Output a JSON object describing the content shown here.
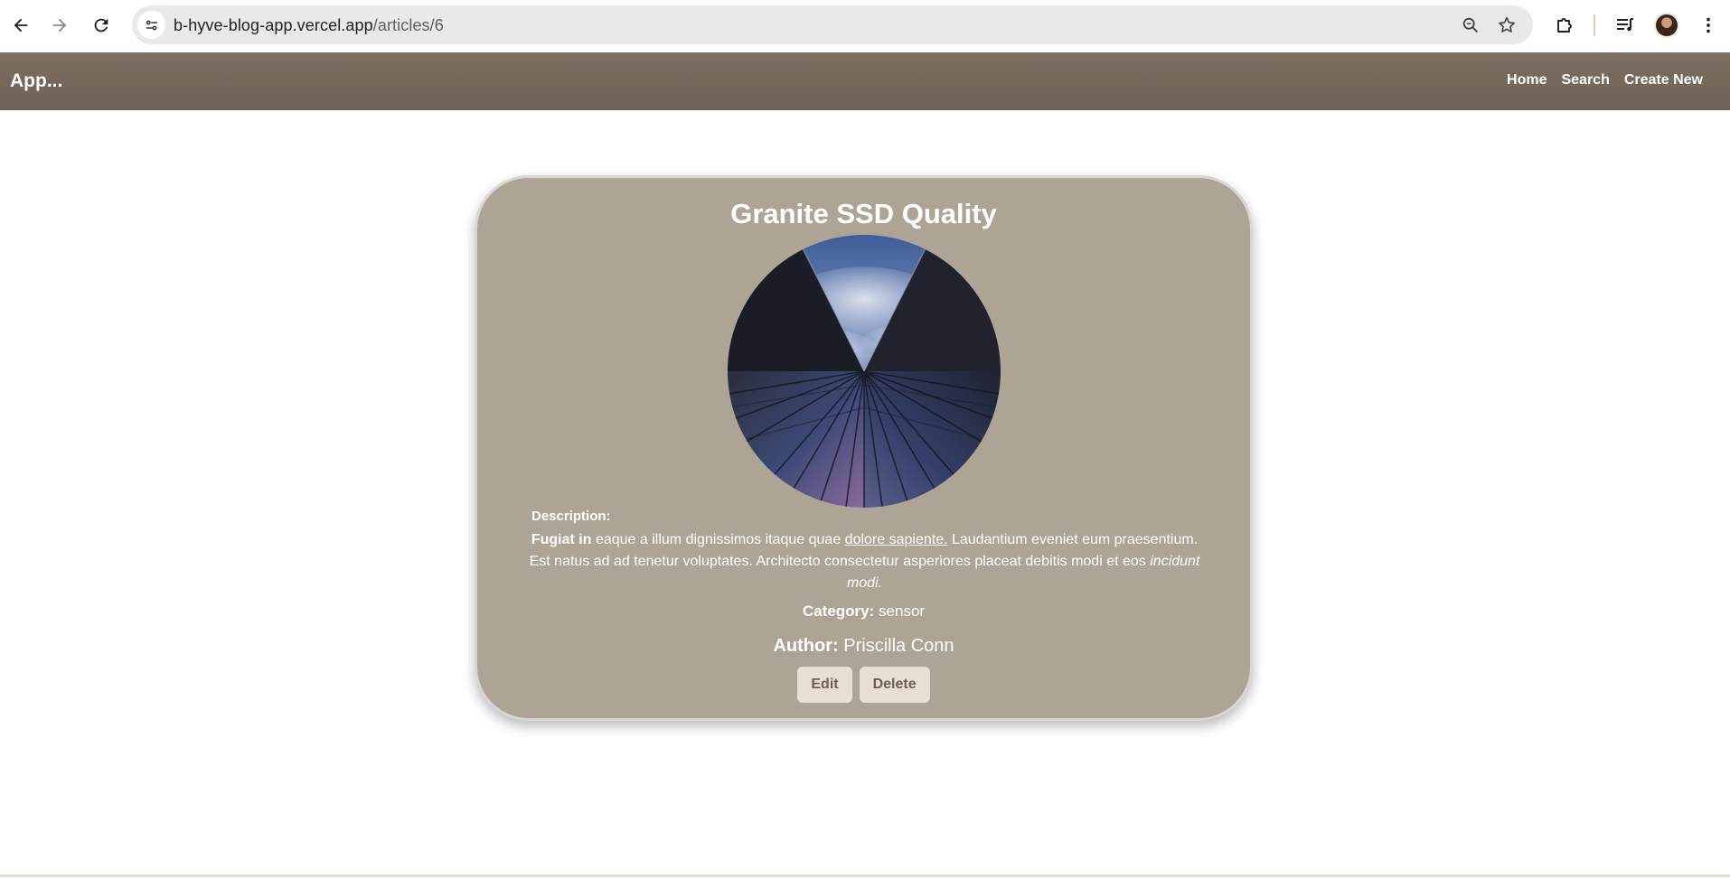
{
  "browser": {
    "url_host": "b-hyve-blog-app.vercel.app",
    "url_path": "/articles/6",
    "icons": [
      "back-arrow-icon",
      "forward-arrow-icon",
      "reload-icon",
      "site-info-icon",
      "zoom-icon",
      "bookmark-star-icon",
      "extensions-icon",
      "media-control-icon",
      "profile-avatar-icon",
      "kebab-menu-icon"
    ]
  },
  "navbar": {
    "brand": "App...",
    "links": [
      "Home",
      "Search",
      "Create New"
    ],
    "background": "#776b5d"
  },
  "article": {
    "title": "Granite SSD Quality",
    "image_alt": "looking up at glass skyscraper towers against a cloudy blue sky",
    "description_label": "Description:",
    "description": {
      "bold": "Fugiat in",
      "part1": " eaque a illum dignissimos itaque quae ",
      "underlined": "dolore sapiente.",
      "part2": " Laudantium eveniet eum praesentium. Est natus ad ad tenetur voluptates. Architecto consectetur asperiores placeat debitis modi et eos ",
      "italic": "incidunt modi."
    },
    "category_label": "Category:",
    "category_value": "sensor",
    "author_label": "Author:",
    "author_value": "Priscilla Conn",
    "edit_label": "Edit",
    "delete_label": "Delete",
    "card_color": "#ada495"
  }
}
